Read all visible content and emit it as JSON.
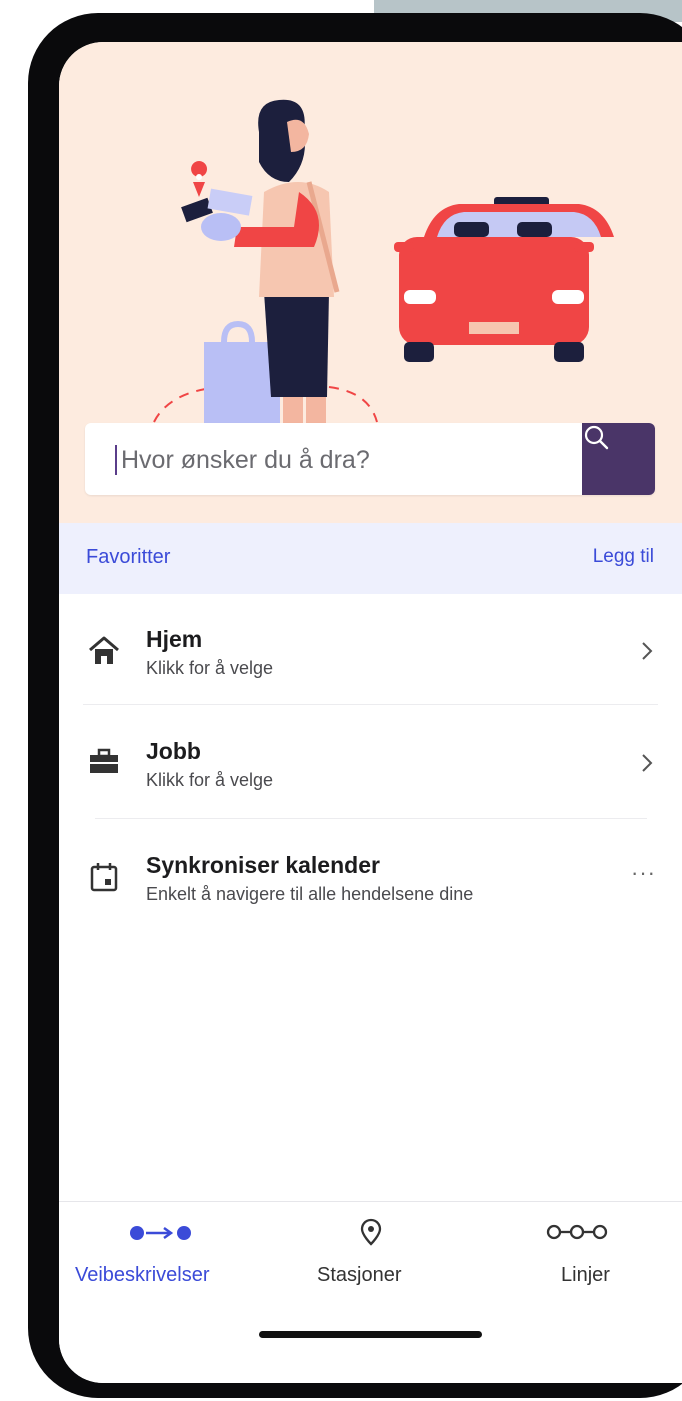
{
  "search": {
    "placeholder": "Hvor ønsker du å dra?"
  },
  "favorites": {
    "title": "Favoritter",
    "add_label": "Legg til"
  },
  "items": [
    {
      "title": "Hjem",
      "subtitle": "Klikk for å velge",
      "icon": "home-icon"
    },
    {
      "title": "Jobb",
      "subtitle": "Klikk for å velge",
      "icon": "briefcase-icon"
    },
    {
      "title": "Synkroniser kalender",
      "subtitle": "Enkelt å navigere til alle hendelsene dine",
      "icon": "calendar-icon",
      "more": "···"
    }
  ],
  "tabs": [
    {
      "label": "Veibeskrivelser",
      "icon": "route-icon",
      "active": true
    },
    {
      "label": "Stasjoner",
      "icon": "location-pin-icon",
      "active": false
    },
    {
      "label": "Linjer",
      "icon": "lines-icon",
      "active": false
    }
  ],
  "colors": {
    "accent": "#3b4bd8",
    "hero_bg": "#fdebdf",
    "search_button": "#4a3568",
    "favorites_bar": "#eef0fd",
    "car": "#f04545"
  }
}
